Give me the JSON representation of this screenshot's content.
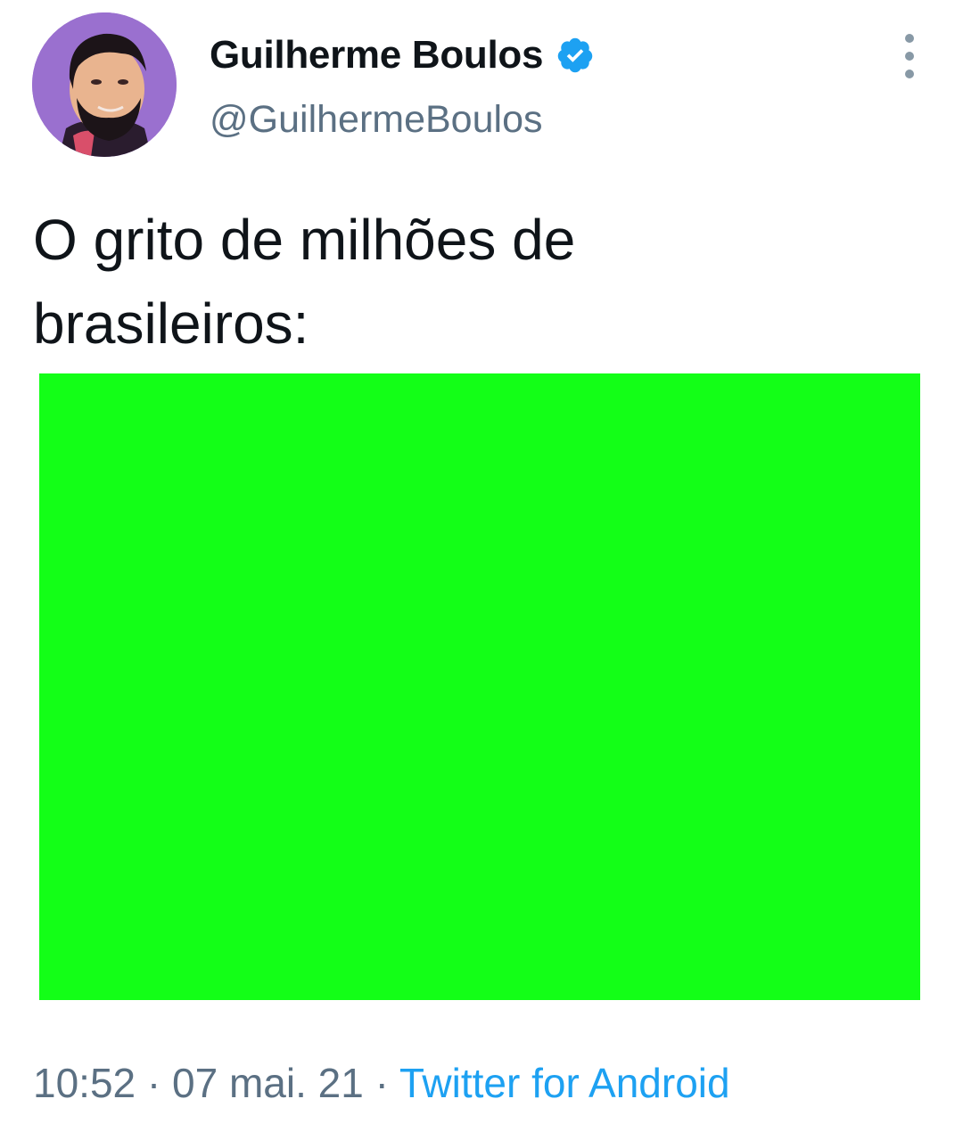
{
  "author": {
    "display_name": "Guilherme Boulos",
    "handle": "@GuilhermeBoulos",
    "verified": true
  },
  "tweet": {
    "text": "O grito de milhões de\nbrasileiros:",
    "media_color": "#13ff17"
  },
  "meta": {
    "time": "10:52",
    "separator_1": " · ",
    "date": "07 mai. 21",
    "separator_2": " · ",
    "source": "Twitter for Android"
  },
  "colors": {
    "text_primary": "#0f1419",
    "text_secondary": "#5b7083",
    "link": "#1da1f2",
    "verified_badge": "#1da1f2",
    "avatar_background": "#9a70cf"
  }
}
